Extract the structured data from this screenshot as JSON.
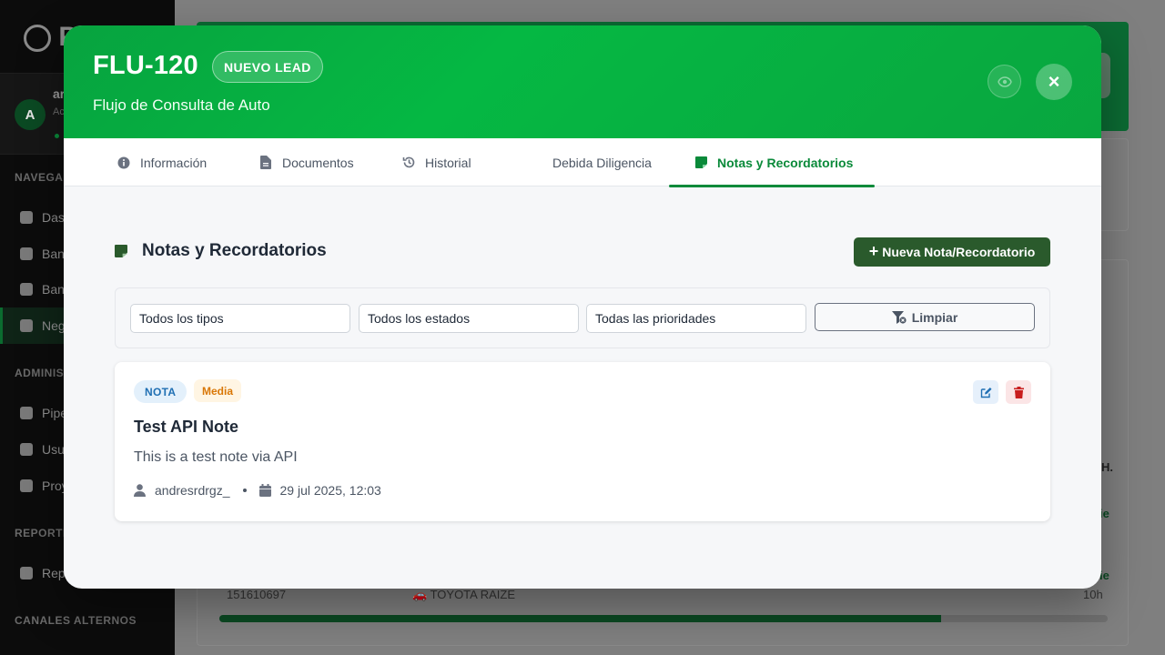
{
  "background": {
    "sidebar": {
      "logo_text": "P",
      "user_initial": "A",
      "user_name": "ar",
      "user_role": "Ac",
      "sections": [
        "NAVEGAC",
        "ADMINIS",
        "REPORTE",
        "CANALES ALTERNOS"
      ],
      "items": [
        "Das",
        "Ban",
        "Ban",
        "Neg",
        "Pipe",
        "Usu",
        "Proy",
        "Repo"
      ]
    },
    "table": {
      "row_id": "151610697",
      "vehicle": "TOYOTA RAIZE",
      "duration": "10h",
      "status_fragment": "ie",
      "edge_text": "H.",
      "progress": 0.813
    }
  },
  "modal": {
    "title": "FLU-120",
    "badge": "NUEVO LEAD",
    "subtitle": "Flujo de Consulta de Auto",
    "close_label": "×",
    "tabs": [
      {
        "label": "Información",
        "icon": "info-circle-icon"
      },
      {
        "label": "Documentos",
        "icon": "file-icon"
      },
      {
        "label": "Historial",
        "icon": "history-icon"
      },
      {
        "label": "Debida Diligencia",
        "icon": ""
      },
      {
        "label": "Notas y Recordatorios",
        "icon": "sticky-note-icon"
      }
    ],
    "active_tab": "Notas y Recordatorios",
    "notes": {
      "title": "Notas y Recordatorios",
      "new_button": "Nueva Nota/Recordatorio",
      "filters": {
        "type": "Todos los tipos",
        "status": "Todos los estados",
        "priority": "Todas las prioridades",
        "clear_button": "Limpiar"
      },
      "items": [
        {
          "type": "NOTA",
          "priority": "Media",
          "title": "Test API Note",
          "body": "This is a test note via API",
          "author": "andresrdrgz_",
          "date": "29 jul 2025, 12:03"
        }
      ]
    }
  },
  "colors": {
    "brand_green": "#07a33f",
    "active_tab": "#0a8a3a",
    "new_button": "#2a5a2c",
    "badge_type": "#1f6fb3",
    "badge_priority": "#d97706",
    "delete": "#c81e1e"
  }
}
